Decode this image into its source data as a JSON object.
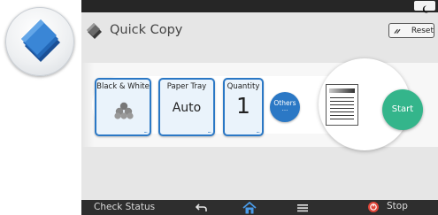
{
  "app": {
    "title": "Quick Copy",
    "reset_label": "Reset"
  },
  "tiles": {
    "color": {
      "label": "Black & White",
      "icon": "toner-icon"
    },
    "paper_tray": {
      "label": "Paper Tray",
      "value": "Auto"
    },
    "quantity": {
      "label": "Quantity",
      "value": "1"
    }
  },
  "others": {
    "label": "Others",
    "dots": "..."
  },
  "start": {
    "label": "Start"
  },
  "bottom_bar": {
    "check_status": "Check Status",
    "stop": "Stop",
    "icons": [
      "back-icon",
      "home-icon",
      "menu-icon",
      "stop-icon"
    ]
  },
  "top_bar": {
    "icon": "moon-icon"
  },
  "colors": {
    "accent_blue": "#2b78c5",
    "start_green": "#34b58b",
    "bar_dark": "#2e2e2e",
    "screen_bg": "#e6e6e6"
  }
}
